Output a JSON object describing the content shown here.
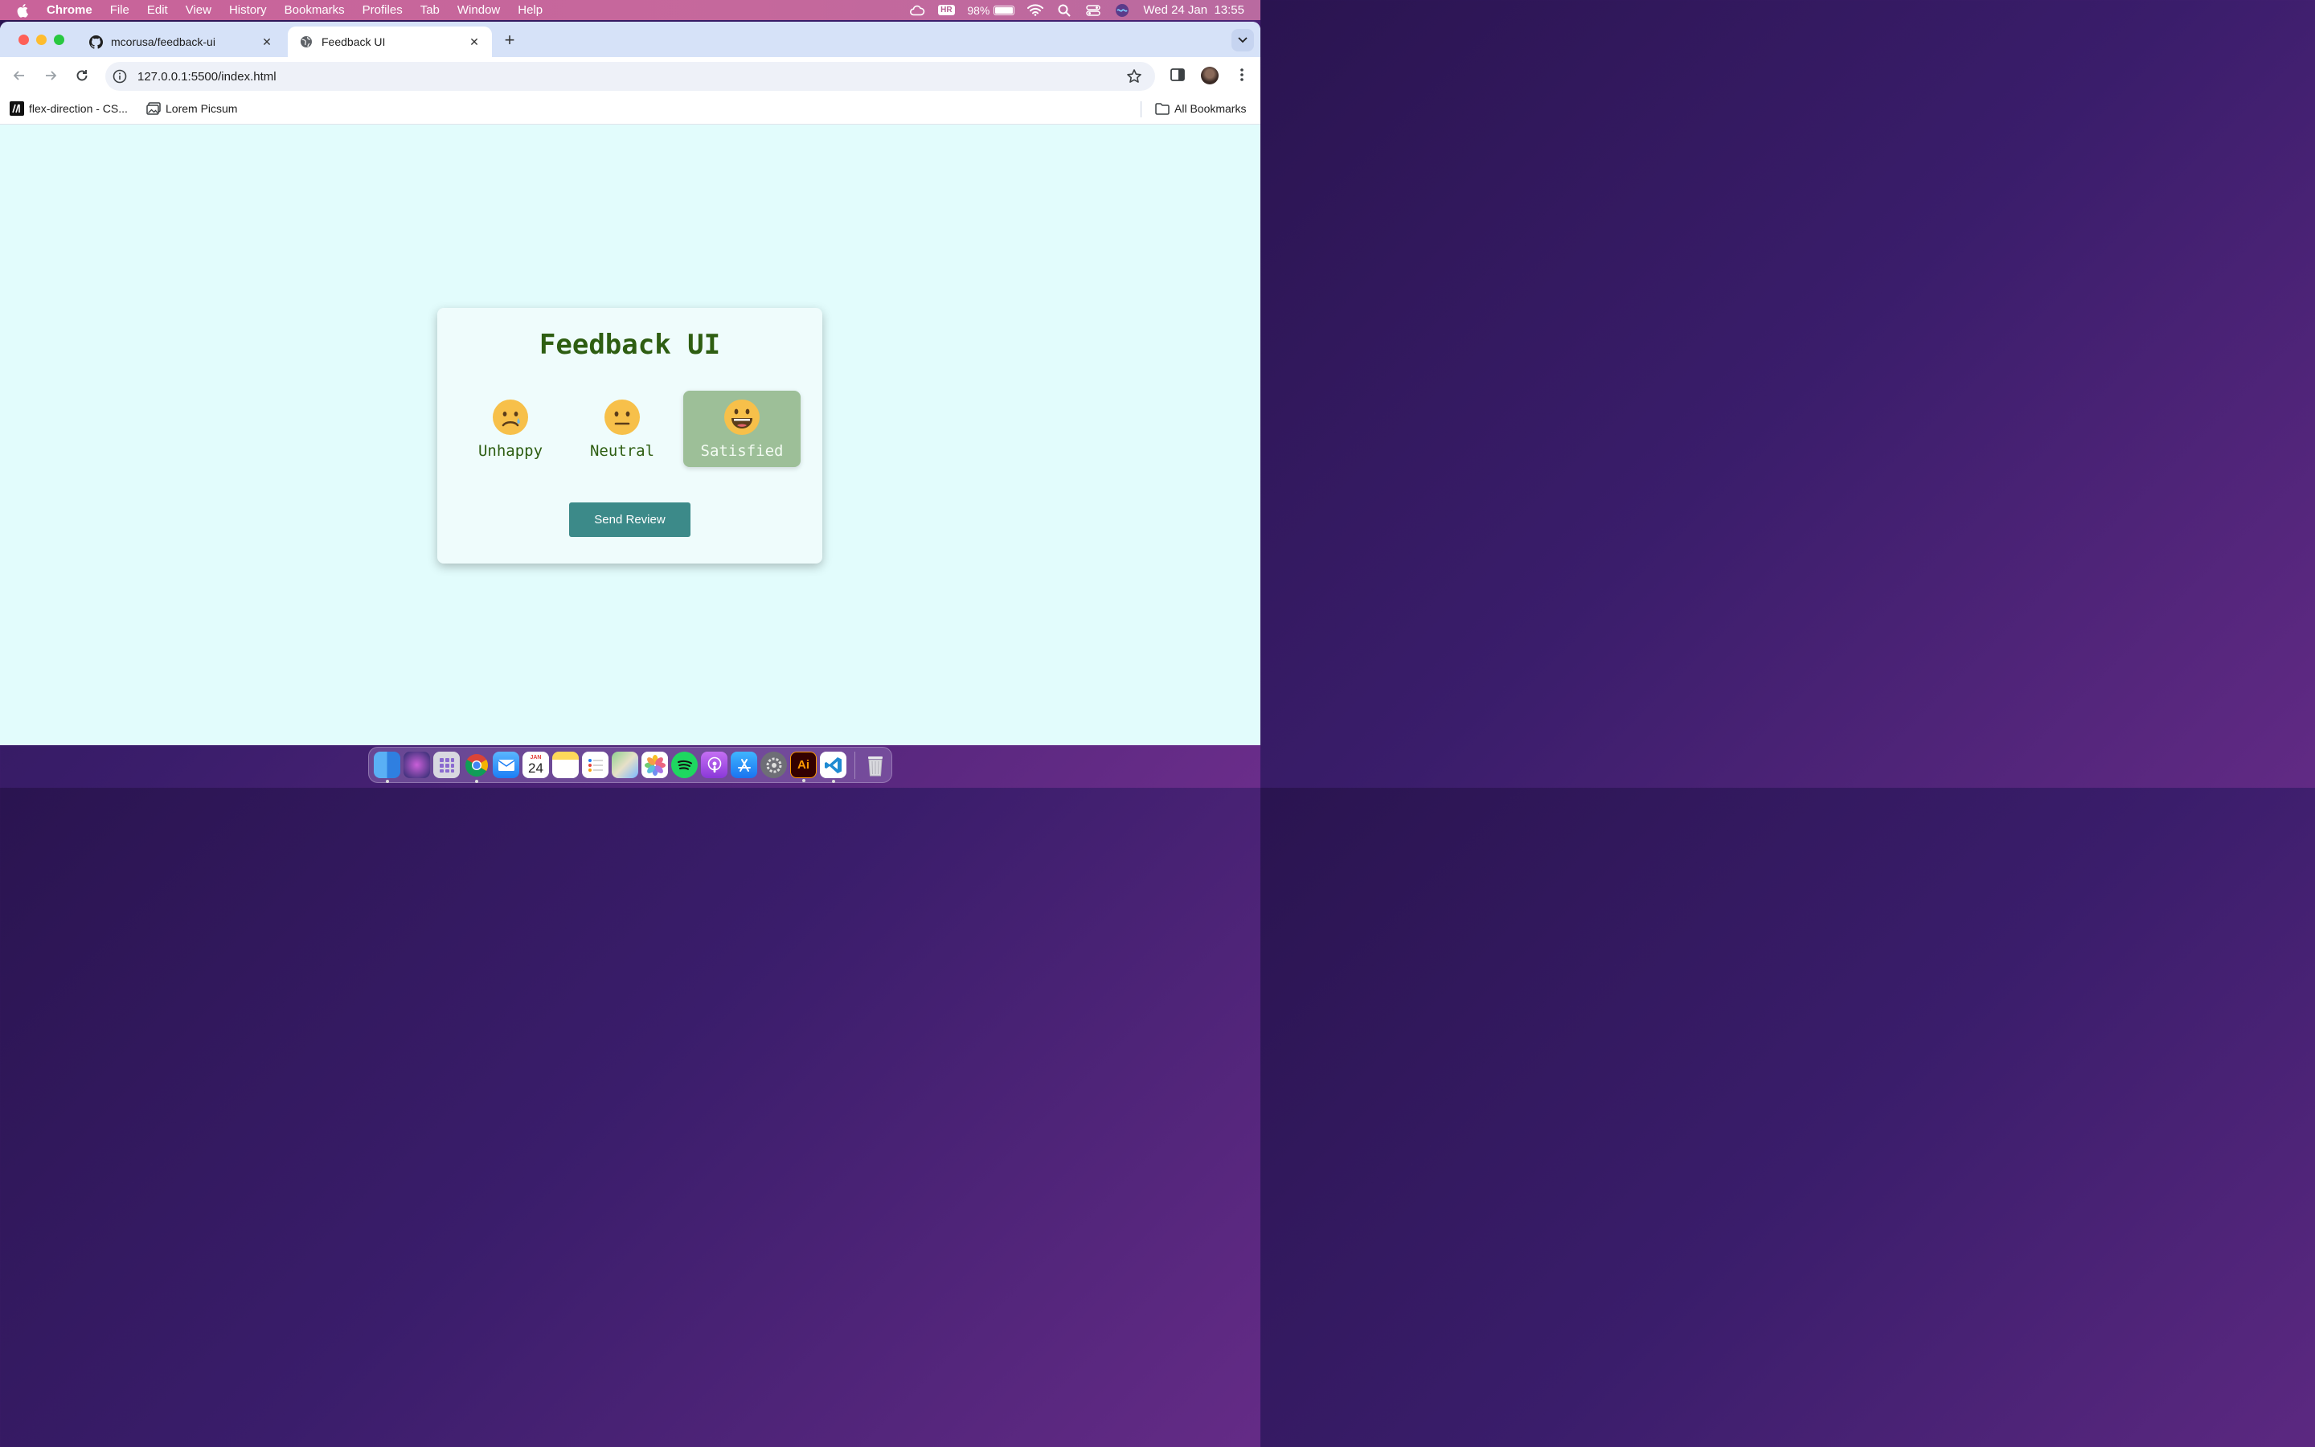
{
  "menubar": {
    "app": "Chrome",
    "items": [
      "File",
      "Edit",
      "View",
      "History",
      "Bookmarks",
      "Profiles",
      "Tab",
      "Window",
      "Help"
    ],
    "battery": "98%",
    "hr_badge": "HR",
    "datetime": "Wed 24 Jan  13:55"
  },
  "tabs": [
    {
      "title": "mcorusa/feedback-ui",
      "favicon": "github-icon",
      "active": false
    },
    {
      "title": "Feedback UI",
      "favicon": "globe-icon",
      "active": true
    }
  ],
  "toolbar": {
    "url": "127.0.0.1:5500/index.html"
  },
  "bookmarks": {
    "items": [
      {
        "label": "flex-direction - CS...",
        "icon": "mdn-icon"
      },
      {
        "label": "Lorem Picsum",
        "icon": "image-icon"
      }
    ],
    "all_bookmarks": "All Bookmarks"
  },
  "feedback": {
    "title": "Feedback UI",
    "ratings": [
      {
        "label": "Unhappy",
        "icon": "sad-face-icon",
        "selected": false
      },
      {
        "label": "Neutral",
        "icon": "neutral-face-icon",
        "selected": false
      },
      {
        "label": "Satisfied",
        "icon": "happy-face-icon",
        "selected": true
      }
    ],
    "send_label": "Send Review",
    "colors": {
      "title": "#2e5e12",
      "selected_bg": "#9dbf98",
      "button_bg": "#3c8a89",
      "page_bg": "#e2fcfc"
    }
  },
  "dock": {
    "calendar_day": "24",
    "calendar_month": "JAN",
    "illustrator_label": "Ai"
  }
}
